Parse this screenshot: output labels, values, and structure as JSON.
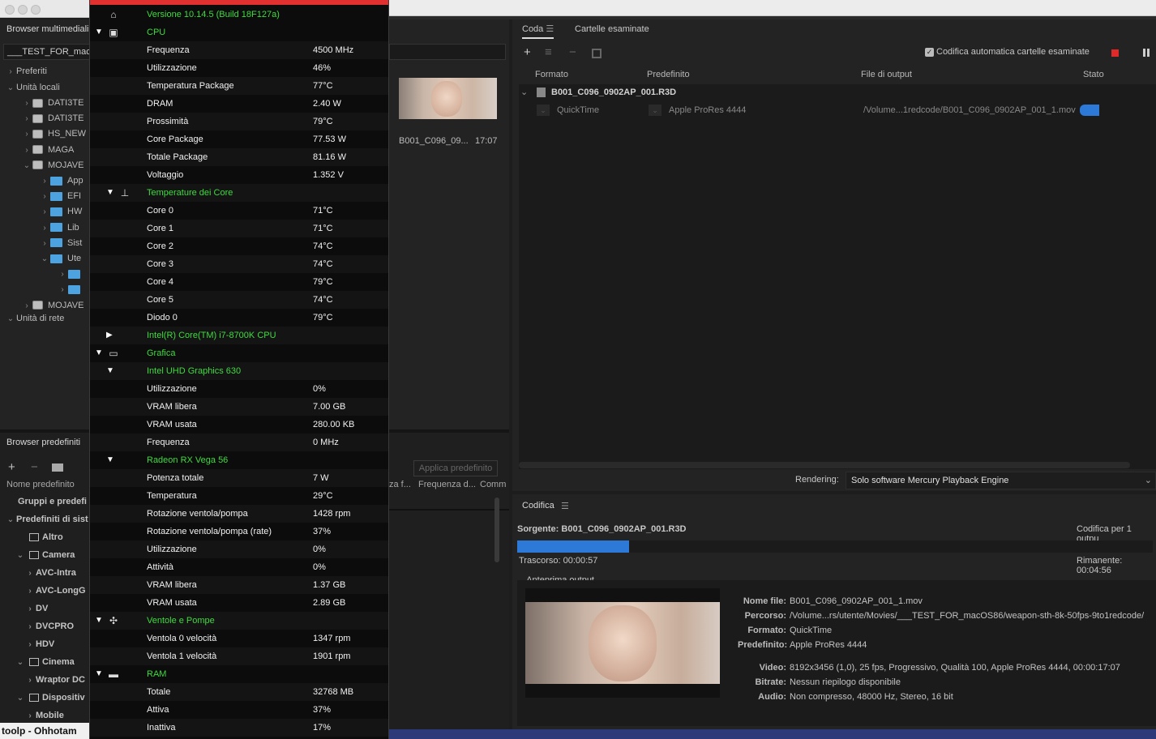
{
  "left": {
    "media_browser_title": "Browser multimediali",
    "path_value": "___TEST_FOR_macO",
    "favorites": "Preferiti",
    "local_units": "Unità locali",
    "tree": [
      "DATI3TE",
      "DATI3TE",
      "HS_NEW",
      "MAGA",
      "MOJAVE",
      "App",
      "EFI",
      "HW",
      "Lib",
      "Sist",
      "Ute",
      "",
      "",
      "MOJAVE"
    ],
    "network_units": "Unità di rete",
    "thumb_name": "B001_C096_09...",
    "thumb_duration": "17:07",
    "preset_browser_title": "Browser predefiniti",
    "preset_col_name": "Nome predefinito",
    "preset_apply": "Applica predefinito",
    "preset_col_frame": "za f...",
    "preset_col_freq": "Frequenza d...",
    "preset_col_comm": "Comm",
    "preset_groups": "Gruppi e predefi",
    "preset_system": "Predefiniti di sist",
    "presets": [
      "Altro",
      "Camera",
      "AVC-Intra",
      "AVC-LongG",
      "DV",
      "DVCPRO",
      "HDV",
      "Cinema",
      "Wraptor DC",
      "Dispositiv",
      "Mobile"
    ],
    "dock_text": "toolp - Ohhotam"
  },
  "hw": {
    "version": "Versione 10.14.5 (Build 18F127a)",
    "rows": [
      {
        "type": "sec",
        "label": "CPU",
        "tri": "down",
        "level": 1
      },
      {
        "type": "item",
        "label": "Frequenza",
        "value": "4500 MHz"
      },
      {
        "type": "item",
        "label": "Utilizzazione",
        "value": "46%"
      },
      {
        "type": "item",
        "label": "Temperatura Package",
        "value": "77°C"
      },
      {
        "type": "item",
        "label": "DRAM",
        "value": "2.40 W"
      },
      {
        "type": "item",
        "label": "Prossimità",
        "value": "79°C"
      },
      {
        "type": "item",
        "label": "Core Package",
        "value": "77.53 W"
      },
      {
        "type": "item",
        "label": "Totale Package",
        "value": "81.16 W"
      },
      {
        "type": "item",
        "label": "Voltaggio",
        "value": "1.352 V"
      },
      {
        "type": "sec",
        "label": "Temperature dei Core",
        "tri": "down",
        "level": 2
      },
      {
        "type": "item",
        "label": "Core 0",
        "value": "71°C"
      },
      {
        "type": "item",
        "label": "Core 1",
        "value": "71°C"
      },
      {
        "type": "item",
        "label": "Core 2",
        "value": "74°C"
      },
      {
        "type": "item",
        "label": "Core 3",
        "value": "74°C"
      },
      {
        "type": "item",
        "label": "Core 4",
        "value": "79°C"
      },
      {
        "type": "item",
        "label": "Core 5",
        "value": "74°C"
      },
      {
        "type": "item",
        "label": "Diodo 0",
        "value": "79°C"
      },
      {
        "type": "sec",
        "label": "Intel(R) Core(TM) i7-8700K CPU",
        "tri": "right",
        "level": 2
      },
      {
        "type": "sec",
        "label": "Grafica",
        "tri": "down",
        "level": 1
      },
      {
        "type": "sec",
        "label": "Intel UHD Graphics 630",
        "tri": "down",
        "level": 2
      },
      {
        "type": "item",
        "label": "Utilizzazione",
        "value": "0%"
      },
      {
        "type": "item",
        "label": "VRAM libera",
        "value": "7.00 GB"
      },
      {
        "type": "item",
        "label": "VRAM usata",
        "value": "280.00 KB"
      },
      {
        "type": "item",
        "label": "Frequenza",
        "value": "0 MHz"
      },
      {
        "type": "sec",
        "label": "Radeon RX Vega 56",
        "tri": "down",
        "level": 2
      },
      {
        "type": "item",
        "label": "Potenza totale",
        "value": "7 W"
      },
      {
        "type": "item",
        "label": "Temperatura",
        "value": "29°C"
      },
      {
        "type": "item",
        "label": "Rotazione ventola/pompa",
        "value": "1428 rpm"
      },
      {
        "type": "item",
        "label": "Rotazione ventola/pompa (rate)",
        "value": "37%"
      },
      {
        "type": "item",
        "label": "Utilizzazione",
        "value": "0%"
      },
      {
        "type": "item",
        "label": "Attività",
        "value": "0%"
      },
      {
        "type": "item",
        "label": "VRAM libera",
        "value": "1.37 GB"
      },
      {
        "type": "item",
        "label": "VRAM usata",
        "value": "2.89 GB"
      },
      {
        "type": "sec",
        "label": "Ventole e Pompe",
        "tri": "down",
        "level": 1
      },
      {
        "type": "item",
        "label": "Ventola 0 velocità",
        "value": "1347 rpm"
      },
      {
        "type": "item",
        "label": "Ventola 1 velocità",
        "value": "1901 rpm"
      },
      {
        "type": "sec",
        "label": "RAM",
        "tri": "down",
        "level": 1
      },
      {
        "type": "item",
        "label": "Totale",
        "value": "32768 MB"
      },
      {
        "type": "item",
        "label": "Attiva",
        "value": "37%"
      },
      {
        "type": "item",
        "label": "Inattiva",
        "value": "17%"
      }
    ]
  },
  "queue": {
    "tab_queue": "Coda",
    "tab_watch": "Cartelle esaminate",
    "auto_encode_label": "Codifica automatica cartelle esaminate",
    "col_format": "Formato",
    "col_preset": "Predefinito",
    "col_output": "File di output",
    "col_status": "Stato",
    "source_file": "B001_C096_0902AP_001.R3D",
    "format": "QuickTime",
    "preset": "Apple ProRes 4444",
    "output": "/Volume...1redcode/B001_C096_0902AP_001_1.mov",
    "rendering_label": "Rendering:",
    "rendering_value": "Solo software Mercury Playback Engine"
  },
  "encoding": {
    "title": "Codifica",
    "source": "Sorgente: B001_C096_0902AP_001.R3D",
    "encoding_for": "Codifica per 1 outpu",
    "elapsed": "Trascorso: 00:00:57",
    "remaining": "Rimanente: 00:04:56",
    "progress": 0.176,
    "preview_toggle": "Anteprima output",
    "info": [
      {
        "k": "Nome file:",
        "v": "B001_C096_0902AP_001_1.mov"
      },
      {
        "k": "Percorso:",
        "v": "/Volume...rs/utente/Movies/___TEST_FOR_macOS86/weapon-sth-8k-50fps-9to1redcode/"
      },
      {
        "k": "Formato:",
        "v": "QuickTime"
      },
      {
        "k": "Predefinito:",
        "v": "Apple ProRes 4444"
      },
      {
        "k": "Video:",
        "v": "8192x3456 (1,0), 25 fps, Progressivo, Qualità 100, Apple ProRes 4444, 00:00:17:07"
      },
      {
        "k": "Bitrate:",
        "v": "Nessun riepilogo disponibile"
      },
      {
        "k": "Audio:",
        "v": "Non compresso, 48000 Hz, Stereo, 16 bit"
      }
    ]
  },
  "colors": {
    "hw_section": "#3ddc3d",
    "accent_blue": "#2d79d8",
    "stop_red": "#e02a2a"
  }
}
